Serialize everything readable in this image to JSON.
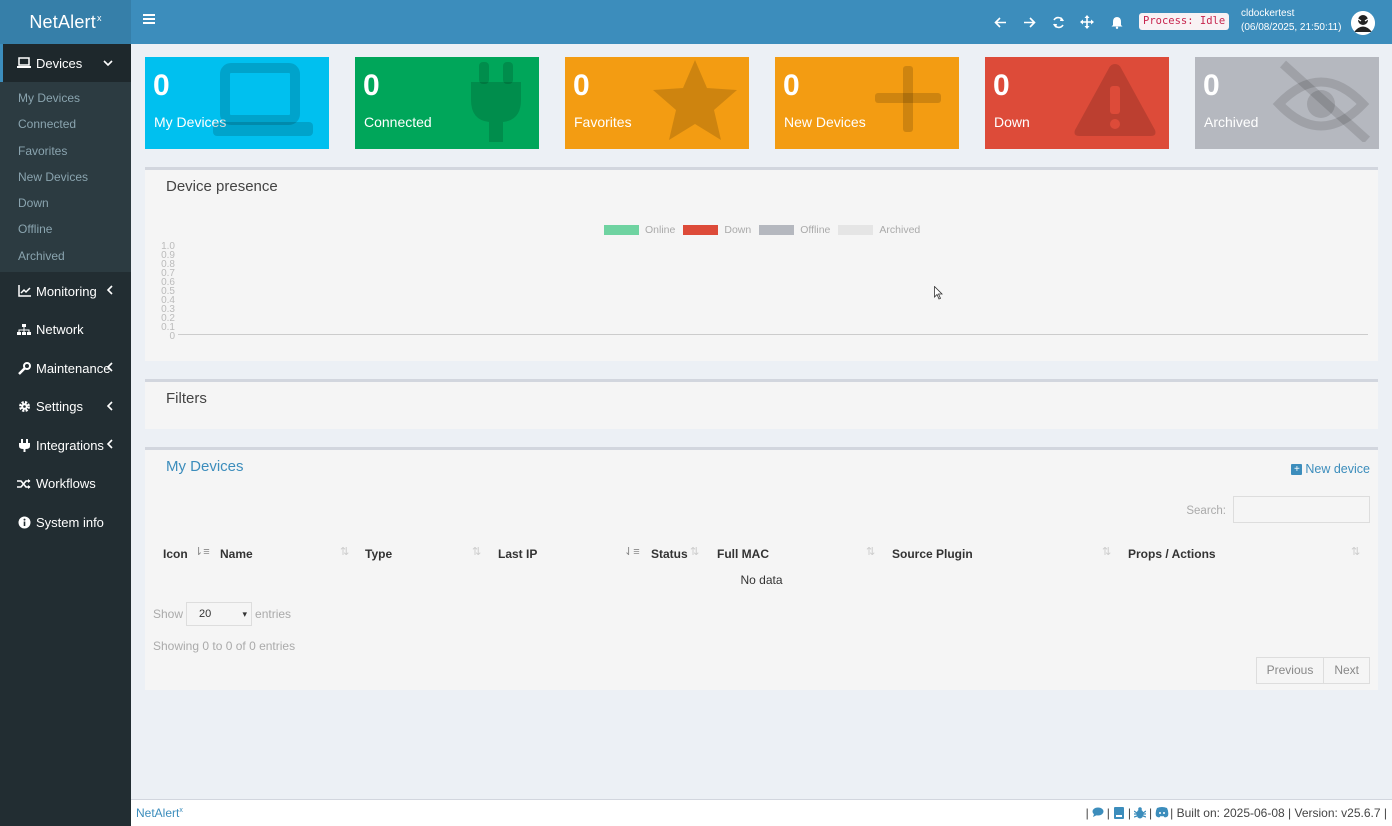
{
  "app": {
    "name": "NetAlert",
    "name_sup": "x"
  },
  "sidebar": {
    "devices_label": "Devices",
    "sub_items": [
      "My Devices",
      "Connected",
      "Favorites",
      "New Devices",
      "Down",
      "Offline",
      "Archived"
    ],
    "items": {
      "monitoring": "Monitoring",
      "network": "Network",
      "maintenance": "Maintenance",
      "settings": "Settings",
      "integrations": "Integrations",
      "workflows": "Workflows",
      "system_info": "System info"
    }
  },
  "header": {
    "process_status": "Process: Idle",
    "user_name": "cldockertest",
    "user_time": "(06/08/2025, 21:50:11)"
  },
  "tiles": [
    {
      "count": "0",
      "label": "My Devices",
      "color": "#00c0ef",
      "icon": "laptop-icon"
    },
    {
      "count": "0",
      "label": "Connected",
      "color": "#00a65a",
      "icon": "plug-icon"
    },
    {
      "count": "0",
      "label": "Favorites",
      "color": "#f39c12",
      "icon": "star-icon"
    },
    {
      "count": "0",
      "label": "New Devices",
      "color": "#f39c12",
      "icon": "plus-icon"
    },
    {
      "count": "0",
      "label": "Down",
      "color": "#dd4b39",
      "icon": "warning-icon"
    },
    {
      "count": "0",
      "label": "Archived",
      "color": "#b5b8bf",
      "icon": "eye-slash-icon"
    }
  ],
  "presence": {
    "title": "Device presence",
    "chart_data": {
      "type": "area",
      "legend": [
        {
          "name": "Online",
          "color": "#6fd3a1"
        },
        {
          "name": "Down",
          "color": "#dd4b39"
        },
        {
          "name": "Offline",
          "color": "#b5b8bf"
        },
        {
          "name": "Archived",
          "color": "#e5e5e5"
        }
      ],
      "y_ticks": [
        "1.0",
        "0.9",
        "0.8",
        "0.7",
        "0.6",
        "0.5",
        "0.4",
        "0.3",
        "0.2",
        "0.1",
        "0"
      ],
      "ylim": [
        0,
        1
      ],
      "series": []
    }
  },
  "filters": {
    "title": "Filters"
  },
  "devices_table": {
    "title": "My Devices",
    "new_device": "New device",
    "search_label": "Search:",
    "search_value": "",
    "columns": [
      "Icon",
      "Name",
      "Type",
      "Last IP",
      "Status",
      "Full MAC",
      "Source Plugin",
      "Props / Actions"
    ],
    "empty_text": "No data",
    "show_label": "Show",
    "page_size": "20",
    "entries_label": "entries",
    "info": "Showing 0 to 0 of 0 entries",
    "prev": "Previous",
    "next": "Next"
  },
  "footer": {
    "brand": "NetAlert",
    "brand_sup": "x",
    "build": "| Built on: 2025-06-08 | Version: v25.6.7 |"
  }
}
